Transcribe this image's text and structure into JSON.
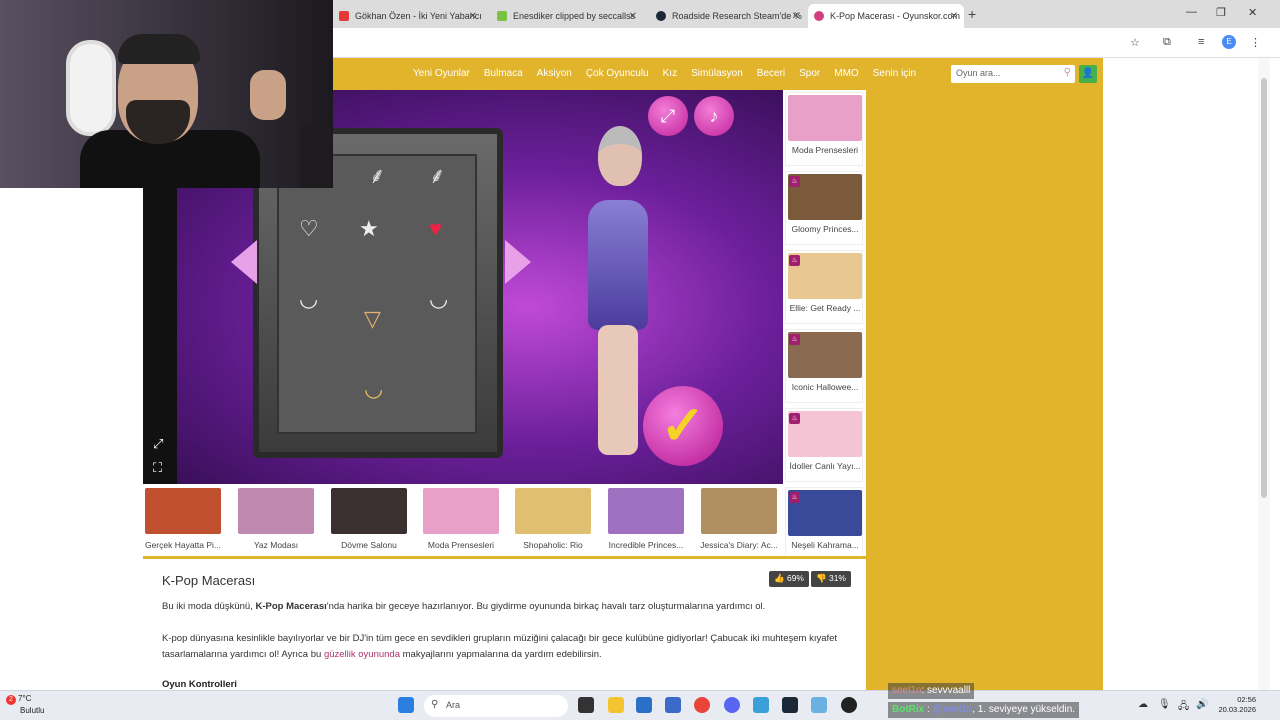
{
  "browser": {
    "tabs": [
      {
        "title": "Gökhan Özen - İki Yeni Yabancı",
        "icon": "youtube-icon",
        "color": "#e53935"
      },
      {
        "title": "Enesdiker clipped by seccallss",
        "icon": "clips-icon",
        "color": "#7cc242"
      },
      {
        "title": "Roadside Research Steam'de %",
        "icon": "steam-icon",
        "color": "#1b2838"
      },
      {
        "title": "K-Pop Macerası - Oyunskor.com",
        "icon": "site-icon",
        "color": "#d04080"
      }
    ],
    "new_tab": "+",
    "profile_initial": "E"
  },
  "site": {
    "nav": [
      "Yeni Oyunlar",
      "Bulmaca",
      "Aksiyon",
      "Çok Oyunculu",
      "Kız",
      "Simülasyon",
      "Beceri",
      "Spor",
      "MMO",
      "Senin için"
    ],
    "search_placeholder": "Oyun ara...",
    "accent": "#e2b42c"
  },
  "side_games": [
    {
      "label": "Moda Prensesleri",
      "hot": false,
      "color": "#e8a0c8"
    },
    {
      "label": "Gloomy Princes...",
      "hot": true,
      "color": "#7a5a3a"
    },
    {
      "label": "Ellie: Get Ready ...",
      "hot": true,
      "color": "#e8c890"
    },
    {
      "label": "Iconic Hallowee...",
      "hot": true,
      "color": "#8a6a50"
    },
    {
      "label": "İdoller Canlı Yayı...",
      "hot": true,
      "color": "#f4c4d4"
    },
    {
      "label": "Neşeli Kahrama...",
      "hot": true,
      "color": "#3a4a9a"
    }
  ],
  "bottom_games": [
    {
      "label": "Gerçek Hayatta Pi...",
      "color": "#c05030"
    },
    {
      "label": "Yaz Modası",
      "color": "#c08ab0"
    },
    {
      "label": "Dövme Salonu",
      "color": "#3a3030"
    },
    {
      "label": "Moda Prensesleri",
      "color": "#e8a0c8"
    },
    {
      "label": "Shopaholic: Rio",
      "color": "#e0c070"
    },
    {
      "label": "Incredible Princes...",
      "color": "#a070c0"
    },
    {
      "label": "Jessica's Diary: Ac...",
      "color": "#b09060"
    }
  ],
  "game": {
    "title": "K-Pop Macerası",
    "like": "69%",
    "dislike": "31%",
    "p1_before": "Bu iki moda düşkünü, ",
    "p1_bold": "K-Pop Macerası",
    "p1_after": "'nda harika bir geceye hazırlanıyor. Bu giydirme oyununda birkaç havalı tarz oluşturmalarına yardımcı ol.",
    "p2_before": "K-pop dünyasına kesinlikle bayılıyorlar ve bir DJ'in tüm gece en sevdikleri grupların müziğini çalacağı bir gece kulübüne gidiyorlar! Çabucak iki muhteşem kıyafet tasarlamalarına yardımcı ol! Ayrıca bu ",
    "p2_link": "güzellik oyununda",
    "p2_after": " makyajlarını yapmalarına da yardım edebilirsin.",
    "controls_heading": "Oyun Kontrolleri"
  },
  "taskbar": {
    "temp": "7°C",
    "weather": "Bulutlu",
    "badge": "2",
    "search": "Ara",
    "time": "02:56",
    "date": "20.03.2026"
  },
  "chat": [
    {
      "user": "seel1n",
      "text": ": sevvvaalll"
    },
    {
      "user": "BotRix",
      "mention": "@seel1n",
      "text": ", 1. seviyeye yükseldin."
    }
  ]
}
